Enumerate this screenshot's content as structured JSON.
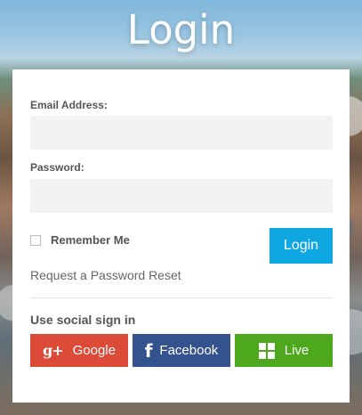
{
  "page": {
    "title": "Login"
  },
  "form": {
    "email_label": "Email Address:",
    "email_value": "",
    "password_label": "Password:",
    "password_value": "",
    "remember_label": "Remember Me",
    "login_button": "Login",
    "reset_link": "Request a Password Reset"
  },
  "social": {
    "title": "Use social sign in",
    "buttons": [
      {
        "label": "Google",
        "icon": "google-plus-icon",
        "color": "#dc4a38"
      },
      {
        "label": "Facebook",
        "icon": "facebook-icon",
        "color": "#34528d"
      },
      {
        "label": "Live",
        "icon": "windows-icon",
        "color": "#4da81d"
      }
    ]
  },
  "colors": {
    "primary": "#0fa7e1",
    "panel_bg": "#ffffff",
    "field_bg": "#f2f2f2"
  }
}
